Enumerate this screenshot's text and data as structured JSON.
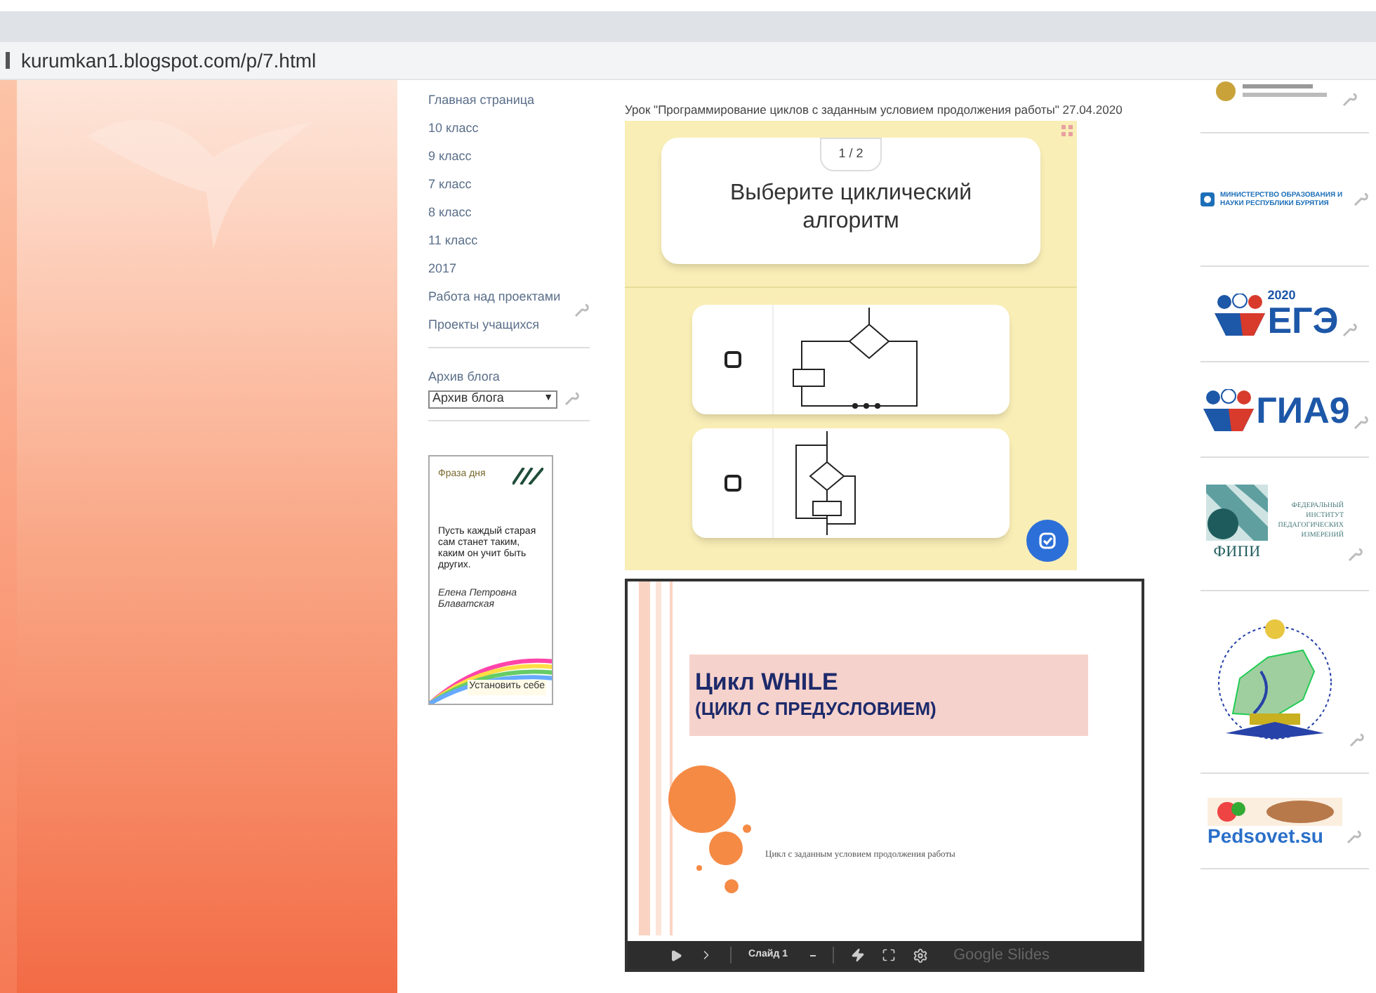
{
  "browser": {
    "url": "kurumkan1.blogspot.com/p/7.html"
  },
  "sidebar": {
    "links": [
      {
        "label": "Главная страница"
      },
      {
        "label": "10 класс"
      },
      {
        "label": "9 класс"
      },
      {
        "label": "7 класс"
      },
      {
        "label": "8 класс"
      },
      {
        "label": "11 класс"
      },
      {
        "label": "2017"
      },
      {
        "label": "Работа над проектами"
      },
      {
        "label": "Проекты учащихся"
      }
    ],
    "archive": {
      "title": "Архив блога",
      "value": "Архив блога",
      "arrow": "▼"
    },
    "phrase": {
      "title": "Фраза дня",
      "quote": "Пусть каждый старая сам станет таким, каким он учит быть других.",
      "author": "Елена Петровна Блаватская",
      "link": "Установить себе"
    }
  },
  "post": {
    "title": "Урок \"Программирование циклов с заданным условием продолжения работы\" 27.04.2020",
    "quiz": {
      "counter": "1 / 2",
      "question": "Выберите циклический алгоритм",
      "options": [
        {
          "kind": "if-loop",
          "checked": false
        },
        {
          "kind": "while-loop",
          "checked": false
        }
      ]
    },
    "slides": {
      "title": "Цикл WHILE",
      "subtitle": "(ЦИКЛ С ПРЕДУСЛОВИЕМ)",
      "caption": "Цикл с заданным условием продолжения работы",
      "slide_label": "Слайд 1",
      "brand": "Google Slides"
    }
  },
  "logos": [
    {
      "kind": "emblem"
    },
    {
      "kind": "ministry",
      "text": "МИНИСТЕРСТВО ОБРАЗОВАНИЯ И НАУКИ РЕСПУБЛИКИ БУРЯТИЯ"
    },
    {
      "kind": "ege",
      "text": "ЕГЭ",
      "year": "2020"
    },
    {
      "kind": "gia",
      "text": "ГИА9"
    },
    {
      "kind": "fipi",
      "text": "ФИПИ",
      "caption": "ФЕДЕРАЛЬНЫЙ ИНСТИТУТ ПЕДАГОГИЧЕСКИХ ИЗМЕРЕНИЙ"
    },
    {
      "kind": "map"
    },
    {
      "kind": "pedsovet",
      "text": "Pedsovet.su"
    }
  ]
}
